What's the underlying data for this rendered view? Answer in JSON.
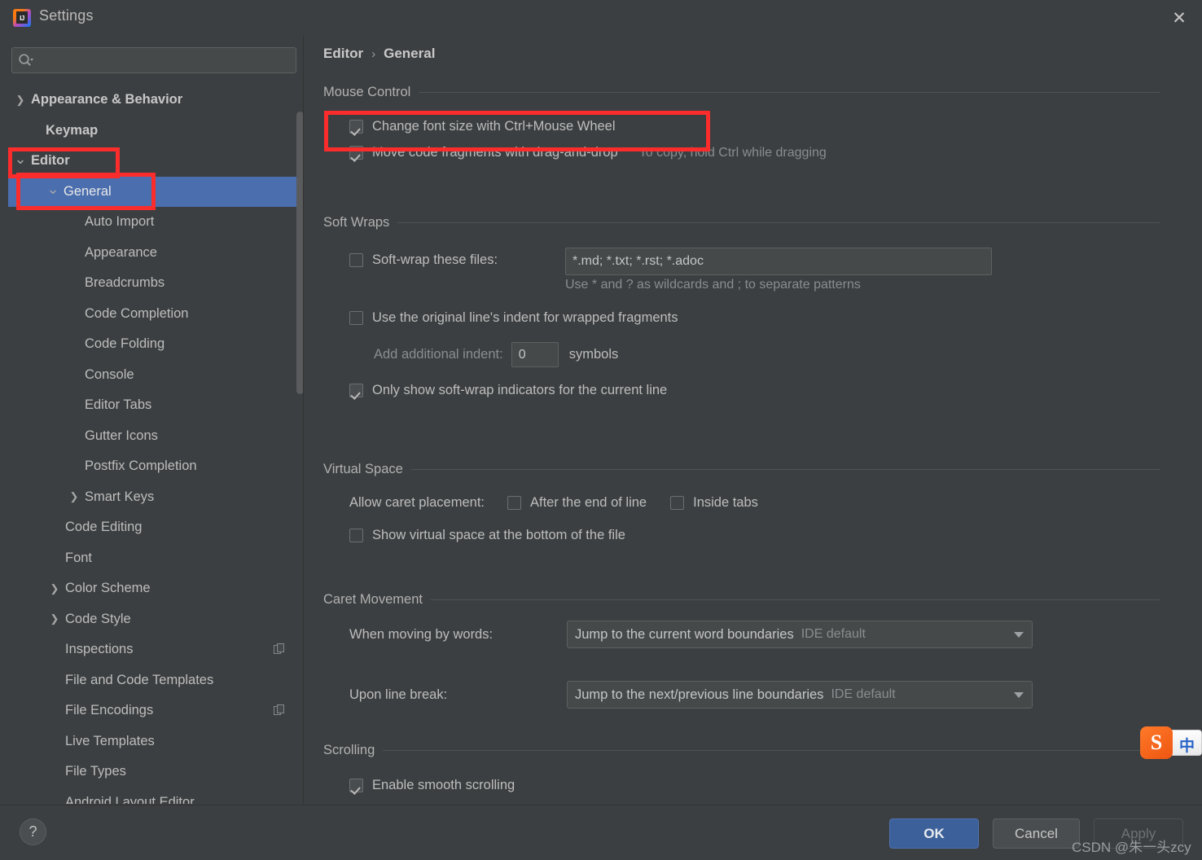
{
  "window": {
    "title": "Settings",
    "app_icon": "intellij-idea-logo",
    "close_icon": "✕"
  },
  "search": {
    "value": "",
    "placeholder": "",
    "icon": "search-icon"
  },
  "sidebar": {
    "items": [
      {
        "label": "Appearance & Behavior",
        "indent": 28,
        "arrow": "collapsed",
        "bold": true,
        "selected": false,
        "copy": false
      },
      {
        "label": "Keymap",
        "indent": 46,
        "arrow": "none",
        "bold": true,
        "selected": false,
        "copy": false
      },
      {
        "label": "Editor",
        "indent": 28,
        "arrow": "expanded",
        "bold": true,
        "selected": false,
        "copy": false
      },
      {
        "label": "General",
        "indent": 68,
        "arrow": "expanded",
        "bold": false,
        "selected": true,
        "copy": false
      },
      {
        "label": "Auto Import",
        "indent": 94,
        "arrow": "none",
        "bold": false,
        "selected": false,
        "copy": false
      },
      {
        "label": "Appearance",
        "indent": 94,
        "arrow": "none",
        "bold": false,
        "selected": false,
        "copy": false
      },
      {
        "label": "Breadcrumbs",
        "indent": 94,
        "arrow": "none",
        "bold": false,
        "selected": false,
        "copy": false
      },
      {
        "label": "Code Completion",
        "indent": 94,
        "arrow": "none",
        "bold": false,
        "selected": false,
        "copy": false
      },
      {
        "label": "Code Folding",
        "indent": 94,
        "arrow": "none",
        "bold": false,
        "selected": false,
        "copy": false
      },
      {
        "label": "Console",
        "indent": 94,
        "arrow": "none",
        "bold": false,
        "selected": false,
        "copy": false
      },
      {
        "label": "Editor Tabs",
        "indent": 94,
        "arrow": "none",
        "bold": false,
        "selected": false,
        "copy": false
      },
      {
        "label": "Gutter Icons",
        "indent": 94,
        "arrow": "none",
        "bold": false,
        "selected": false,
        "copy": false
      },
      {
        "label": "Postfix Completion",
        "indent": 94,
        "arrow": "none",
        "bold": false,
        "selected": false,
        "copy": false
      },
      {
        "label": "Smart Keys",
        "indent": 94,
        "arrow": "collapsed",
        "bold": false,
        "selected": false,
        "copy": false
      },
      {
        "label": "Code Editing",
        "indent": 70,
        "arrow": "none",
        "bold": false,
        "selected": false,
        "copy": false
      },
      {
        "label": "Font",
        "indent": 70,
        "arrow": "none",
        "bold": false,
        "selected": false,
        "copy": false
      },
      {
        "label": "Color Scheme",
        "indent": 70,
        "arrow": "collapsed",
        "bold": false,
        "selected": false,
        "copy": false
      },
      {
        "label": "Code Style",
        "indent": 70,
        "arrow": "collapsed",
        "bold": false,
        "selected": false,
        "copy": false
      },
      {
        "label": "Inspections",
        "indent": 70,
        "arrow": "none",
        "bold": false,
        "selected": false,
        "copy": true
      },
      {
        "label": "File and Code Templates",
        "indent": 70,
        "arrow": "none",
        "bold": false,
        "selected": false,
        "copy": false
      },
      {
        "label": "File Encodings",
        "indent": 70,
        "arrow": "none",
        "bold": false,
        "selected": false,
        "copy": true
      },
      {
        "label": "Live Templates",
        "indent": 70,
        "arrow": "none",
        "bold": false,
        "selected": false,
        "copy": false
      },
      {
        "label": "File Types",
        "indent": 70,
        "arrow": "none",
        "bold": false,
        "selected": false,
        "copy": false
      },
      {
        "label": "Android Layout Editor",
        "indent": 70,
        "arrow": "none",
        "bold": false,
        "selected": false,
        "copy": false
      }
    ]
  },
  "breadcrumb": {
    "root": "Editor",
    "separator": "›",
    "leaf": "General"
  },
  "groups": {
    "mouse_control": {
      "title": "Mouse Control",
      "change_font_size": {
        "label": "Change font size with Ctrl+Mouse Wheel",
        "checked": true
      },
      "move_code_fragments": {
        "label": "Move code fragments with drag-and-drop",
        "checked": true
      },
      "drag_hint": "To copy, hold Ctrl while dragging"
    },
    "soft_wraps": {
      "title": "Soft Wraps",
      "soft_wrap_files": {
        "label": "Soft-wrap these files:",
        "checked": false
      },
      "soft_wrap_value": "*.md; *.txt; *.rst; *.adoc",
      "soft_wrap_placeholder": "*.md; *.txt; *.rst; *.adoc",
      "wildcard_hint": "Use * and ? as wildcards and ; to separate patterns",
      "original_indent": {
        "label": "Use the original line's indent for wrapped fragments",
        "checked": false
      },
      "additional_indent_label": "Add additional indent:",
      "additional_indent_value": "0",
      "symbols_label": "symbols",
      "only_show_indicators": {
        "label": "Only show soft-wrap indicators for the current line",
        "checked": true
      }
    },
    "virtual_space": {
      "title": "Virtual Space",
      "allow_caret_label": "Allow caret placement:",
      "after_end_of_line": {
        "label": "After the end of line",
        "checked": false
      },
      "inside_tabs": {
        "label": "Inside tabs",
        "checked": false
      },
      "show_virtual_space": {
        "label": "Show virtual space at the bottom of the file",
        "checked": false
      }
    },
    "caret_movement": {
      "title": "Caret Movement",
      "when_moving_by_words_label": "When moving by words:",
      "when_moving_by_words_value": "Jump to the current word boundaries",
      "when_moving_by_words_sub": "IDE default",
      "upon_line_break_label": "Upon line break:",
      "upon_line_break_value": "Jump to the next/previous line boundaries",
      "upon_line_break_sub": "IDE default"
    },
    "scrolling": {
      "title": "Scrolling",
      "enable_smooth_scrolling": {
        "label": "Enable smooth scrolling",
        "checked": true
      }
    }
  },
  "footer": {
    "help_icon": "?",
    "ok_label": "OK",
    "cancel_label": "Cancel",
    "apply_label": "Apply"
  },
  "ime_widget": {
    "logo_letter": "S",
    "mode_label": "中"
  },
  "watermark": "CSDN @朱一头zcy",
  "colors": {
    "window_bg": "#3c3f41",
    "selection_blue": "#4b6eaf",
    "annotation_red": "#fb2c2c",
    "ok_button_blue": "#3c6099",
    "text_primary": "#bdbdbd",
    "text_dim": "#8a8d8f"
  }
}
